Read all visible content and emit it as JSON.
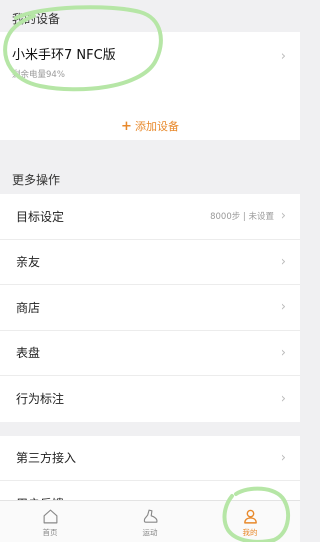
{
  "my_devices": {
    "header": "我的设备",
    "device_name": "小米手环7 NFC版",
    "battery_text": "剩余电量94%",
    "add_device_label": "添加设备"
  },
  "more_actions": {
    "header": "更多操作",
    "items": [
      {
        "label": "目标设定",
        "meta": "8000步 | 未设置"
      },
      {
        "label": "亲友"
      },
      {
        "label": "商店"
      },
      {
        "label": "表盘"
      },
      {
        "label": "行为标注"
      }
    ]
  },
  "other_items": [
    {
      "label": "第三方接入"
    },
    {
      "label": "用户反馈"
    }
  ],
  "tabbar": {
    "tabs": [
      {
        "label": "首页",
        "icon": "home-icon"
      },
      {
        "label": "运动",
        "icon": "sneaker-icon"
      },
      {
        "label": "我的",
        "icon": "person-icon",
        "active": true
      }
    ]
  },
  "colors": {
    "accent": "#e8892b",
    "annotation": "#b6e6a6",
    "background": "#f0f0f2"
  }
}
